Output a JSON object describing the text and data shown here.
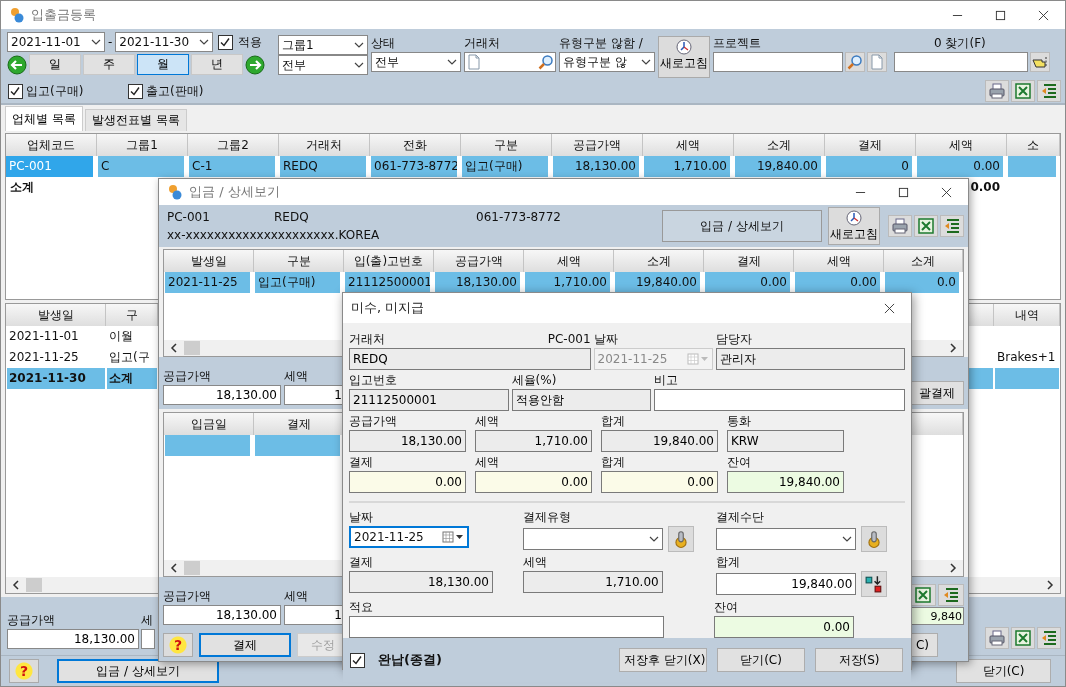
{
  "main": {
    "title": "입출금등록",
    "date_from": "2021-11-01",
    "date_sep": "-",
    "date_to": "2021-11-30",
    "apply": {
      "label": "적용",
      "checked": true
    },
    "periods": [
      {
        "label": "일",
        "selected": false
      },
      {
        "label": "주",
        "selected": false
      },
      {
        "label": "월",
        "selected": true
      },
      {
        "label": "년",
        "selected": false
      }
    ],
    "group_combo": "그룹1",
    "group_value": "전부",
    "status": {
      "label": "상태",
      "value": "전부"
    },
    "partner": {
      "label": "거래처"
    },
    "type": {
      "label": "유형구분 않함 /",
      "value": "유형구분 않"
    },
    "refresh": "새로고침",
    "project": {
      "label": "프로젝트"
    },
    "find": {
      "label": "0 찾기(F)"
    },
    "kinds": [
      {
        "label": "입고(구매)",
        "checked": true
      },
      {
        "label": "출고(판매)",
        "checked": true
      }
    ],
    "tabs": [
      {
        "label": "업체별 목록",
        "selected": true
      },
      {
        "label": "발생전표별 목록",
        "selected": false
      }
    ],
    "company_table": {
      "columns": [
        "업체코드",
        "그룹1",
        "그룹2",
        "거래처",
        "전화",
        "구분",
        "공급가액",
        "세액",
        "소계",
        "결제",
        "세액",
        "소"
      ],
      "rows": [
        {
          "kind": "item",
          "selected": true,
          "cells": [
            "PC-001",
            "C",
            "C-1",
            "REDQ",
            "061-773-8772",
            "입고(구매)",
            "18,130.00",
            "1,710.00",
            "19,840.00",
            "0",
            "0.00"
          ]
        },
        {
          "kind": "subtotal",
          "selected": false,
          "label": "소계",
          "tax": "0.00"
        }
      ]
    },
    "history_table": {
      "columns": [
        "발생일",
        "구",
        "내역"
      ],
      "rows": [
        {
          "kind": "item",
          "selected": false,
          "date": "2021-11-01",
          "type": "이월"
        },
        {
          "kind": "item",
          "selected": false,
          "date": "2021-11-25",
          "type": "입고(구",
          "memo": "Brakes+1"
        },
        {
          "kind": "subtotal",
          "selected": true,
          "date": "2021-11-30",
          "type": "소계"
        }
      ]
    },
    "totals": {
      "supply_label": "공급가액",
      "supply": "18,130.00",
      "tax_label": "세"
    },
    "help": "?",
    "detail_button": "입금 / 상세보기",
    "close_button": "닫기(C)"
  },
  "detail": {
    "title": "입금 / 상세보기",
    "code": "PC-001",
    "name": "REDQ",
    "phone": "061-773-8772",
    "address": "xx-xxxxxxxxxxxxxxxxxxxxx.KOREA",
    "caption": "입금 / 상세보기",
    "refresh": "새로고침",
    "table": {
      "columns": [
        "발생일",
        "구분",
        "입(출)고번호",
        "공급가액",
        "세액",
        "소계",
        "결제",
        "세액",
        "소계"
      ],
      "rows": [
        {
          "selected": true,
          "cells": [
            "2021-11-25",
            "입고(구매)",
            "21112500001",
            "18,130.00",
            "1,710.00",
            "19,840.00",
            "0.00",
            "0.00",
            "0.0"
          ]
        }
      ]
    },
    "totals": {
      "supply_label": "공급가액",
      "supply": "18,130.00",
      "tax_label": "세액",
      "tax": "1"
    },
    "bulk_button": "괄결제",
    "payments": {
      "columns": [
        "입금일",
        "결제"
      ],
      "rows": [
        {
          "selected": true
        }
      ]
    },
    "payment_totals": {
      "supply_label": "공급가액",
      "supply": "18,130.00",
      "tax_label": "세액",
      "tax": "1",
      "balance": "9,840"
    },
    "help": "?",
    "pay_button": {
      "label": "결제",
      "focused": true
    },
    "edit_button": {
      "label": "수정",
      "disabled": true
    },
    "close_fragment": "C)"
  },
  "dialog": {
    "title": "미수, 미지급",
    "partner": {
      "label": "거래처",
      "value": "REDQ"
    },
    "code": "PC-001",
    "date": {
      "label": "날짜",
      "value": "2021-11-25",
      "disabled": true
    },
    "manager": {
      "label": "담당자",
      "value": "관리자"
    },
    "receipt_no": {
      "label": "입고번호",
      "value": "21112500001"
    },
    "tax_rate": {
      "label": "세율(%)",
      "value": "적용안함"
    },
    "note": {
      "label": "비고"
    },
    "amounts": [
      {
        "kind": "plain",
        "label": "공급가액",
        "value": "18,130.00"
      },
      {
        "kind": "plain",
        "label": "세액",
        "value": "1,710.00"
      },
      {
        "kind": "plain",
        "label": "합계",
        "value": "19,840.00"
      },
      {
        "kind": "text",
        "label": "통화",
        "value": "KRW"
      }
    ],
    "paid": [
      {
        "kind": "paid",
        "label": "결제",
        "value": "0.00"
      },
      {
        "kind": "paid",
        "label": "세액",
        "value": "0.00"
      },
      {
        "kind": "paid",
        "label": "합계",
        "value": "0.00"
      },
      {
        "kind": "balance",
        "label": "잔여",
        "value": "19,840.00"
      }
    ],
    "pay_date": {
      "label": "날짜",
      "value": "2021-11-25",
      "focused": true
    },
    "pay_type": {
      "label": "결제유형"
    },
    "pay_method": {
      "label": "결제수단"
    },
    "pay_amount": {
      "label": "결제",
      "value": "18,130.00"
    },
    "pay_tax": {
      "label": "세액",
      "value": "1,710.00"
    },
    "pay_total": {
      "label": "합계",
      "value": "19,840.00"
    },
    "memo": {
      "label": "적요"
    },
    "remain": {
      "label": "잔여",
      "value": "0.00"
    },
    "complete": {
      "label": "완납(종결)",
      "checked": true
    },
    "buttons": [
      "저장후 닫기(X)",
      "닫기(C)",
      "저장(S)"
    ]
  }
}
